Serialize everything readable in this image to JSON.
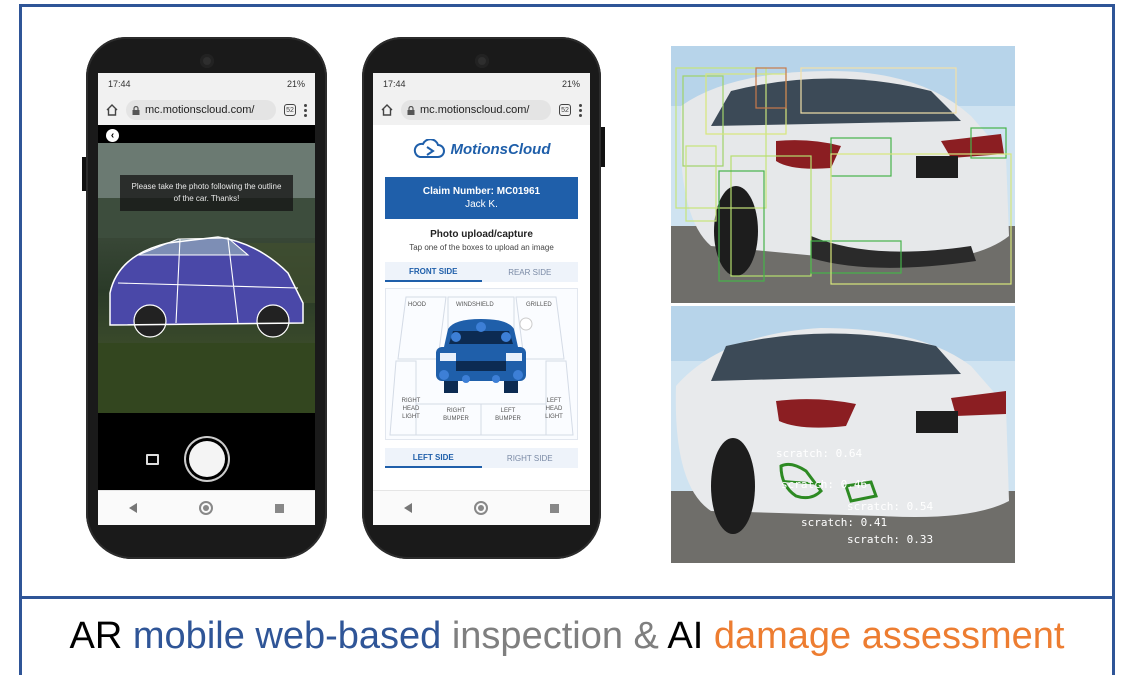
{
  "caption": {
    "w1": "AR",
    "w2": "mobile web-based",
    "w3": "inspection &",
    "w4": "AI",
    "w5": "damage assessment",
    "colors": {
      "black": "#000000",
      "blue": "#2f5597",
      "gray": "#7f7f7f",
      "orange": "#ed7d31"
    }
  },
  "phone1": {
    "time": "17:44",
    "battery": "21%",
    "url": "mc.motionscloud.com/",
    "tabs": "52",
    "camera_message": "Please take the photo following the outline of the car. Thanks!"
  },
  "phone2": {
    "time": "17:44",
    "battery": "21%",
    "url": "mc.motionscloud.com/",
    "tabs": "52",
    "logo": "MotionsCloud",
    "claim_number": "Claim Number: MC01961",
    "claimant": "Jack K.",
    "heading": "Photo upload/capture",
    "subheading": "Tap one of the boxes to upload an image",
    "tabs_top": [
      "FRONT SIDE",
      "REAR SIDE"
    ],
    "zones": {
      "hood": "HOOD",
      "windshield": "WINDSHIELD",
      "grilled": "GRILLED",
      "right_head_light": "RIGHT HEAD LIGHT",
      "right_bumper": "RIGHT BUMPER",
      "left_bumper": "LEFT BUMPER",
      "left_head_light": "LEFT HEAD LIGHT"
    },
    "tabs_bottom": [
      "LEFT SIDE",
      "RIGHT SIDE"
    ]
  },
  "detections": [
    {
      "label": "scratch: 0.64"
    },
    {
      "label": "scratch: 0.46"
    },
    {
      "label": "scratch: 0.54"
    },
    {
      "label": "scratch: 0.41"
    },
    {
      "label": "scratch: 0.33"
    }
  ]
}
